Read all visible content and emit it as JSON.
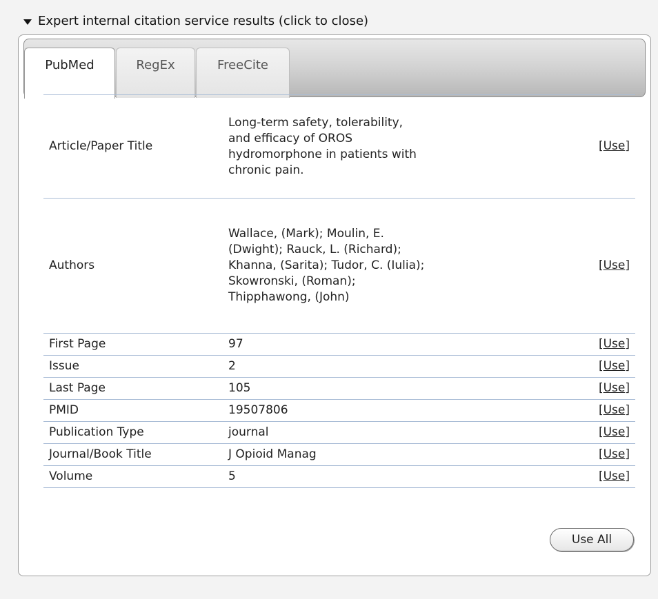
{
  "header": {
    "title": "Expert internal citation service results (click to close)"
  },
  "tabs": [
    {
      "label": "PubMed",
      "active": true
    },
    {
      "label": "RegEx",
      "active": false
    },
    {
      "label": "FreeCite",
      "active": false
    }
  ],
  "results": {
    "use_prefix": "[",
    "use_label": "Use",
    "use_suffix": "]",
    "rows": [
      {
        "field": "Article/Paper Title",
        "value": "Long-term safety, tolerability, and efficacy of OROS hydromorphone in patients with chronic pain."
      },
      {
        "field": "Authors",
        "value": "Wallace, (Mark); Moulin, E. (Dwight); Rauck, L. (Richard); Khanna, (Sarita); Tudor, C. (Iulia); Skowronski, (Roman); Thipphawong, (John)"
      },
      {
        "field": "First Page",
        "value": "97"
      },
      {
        "field": "Issue",
        "value": "2"
      },
      {
        "field": "Last Page",
        "value": "105"
      },
      {
        "field": "PMID",
        "value": "19507806"
      },
      {
        "field": "Publication Type",
        "value": "journal"
      },
      {
        "field": "Journal/Book Title",
        "value": "J Opioid Manag"
      },
      {
        "field": "Volume",
        "value": "5"
      }
    ],
    "use_all_label": "Use All"
  },
  "colors": {
    "row_border": "#a9bcd6",
    "panel_border": "#9c9c9c",
    "background": "#f3f3f3"
  }
}
